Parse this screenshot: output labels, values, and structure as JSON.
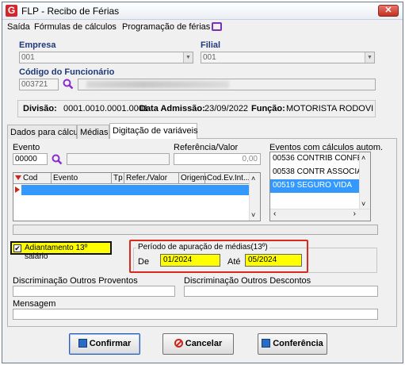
{
  "window": {
    "title": "FLP - Recibo de Férias",
    "close_glyph": "✕",
    "app_icon_letter": "G"
  },
  "menu": {
    "items": [
      "Saída",
      "Fórmulas de cálculos",
      "Programação de férias"
    ]
  },
  "empresa": {
    "label": "Empresa",
    "value": "001"
  },
  "filial": {
    "label": "Filial",
    "value": "001"
  },
  "funcionario": {
    "label": "Código do Funcionário",
    "value": "003721"
  },
  "info": {
    "divisao_label": "Divisão:",
    "divisao_value": "0001.0010.0001.0001",
    "admissao_label": "Data Admissão:",
    "admissao_value": "23/09/2022",
    "funcao_label": "Função:",
    "funcao_value": "MOTORISTA RODOVI"
  },
  "tabs": [
    "Dados para cálculo",
    "Médias",
    "Digitação de variáveis"
  ],
  "active_tab": "Digitação de variáveis",
  "evento": {
    "label": "Evento",
    "value": "00000"
  },
  "referencia": {
    "label": "Referência/Valor",
    "value": "0,00"
  },
  "grid": {
    "headers": [
      "Cod",
      "Evento",
      "Tp",
      "Refer./Valor",
      "Origem",
      "Cod.Ev.Int..."
    ]
  },
  "eventos_calculos": {
    "label": "Eventos com cálculos autom.",
    "items": [
      {
        "code": "00536",
        "name": "CONTRIB CONFED"
      },
      {
        "code": "00538",
        "name": "CONTR ASSOCIATI"
      },
      {
        "code": "00519",
        "name": "SEGURO VIDA"
      }
    ]
  },
  "adiantamento": {
    "label": "Adiantamento 13º salário",
    "checked": true
  },
  "periodo": {
    "label": "Período de apuração de médias(13º)",
    "de_label": "De",
    "de_value": "01/2024",
    "ate_label": "Até",
    "ate_value": "05/2024"
  },
  "discriminacao_proventos": {
    "label": "Discriminação Outros Proventos"
  },
  "discriminacao_descontos": {
    "label": "Discriminação Outros Descontos"
  },
  "mensagem": {
    "label": "Mensagem"
  },
  "buttons": {
    "confirmar": "Confirmar",
    "cancelar": "Cancelar",
    "conferencia": "Conferência"
  },
  "colors": {
    "accent_blue": "#3399ff",
    "highlight_yellow": "#ffff00",
    "callout_red": "#d92a1f"
  }
}
